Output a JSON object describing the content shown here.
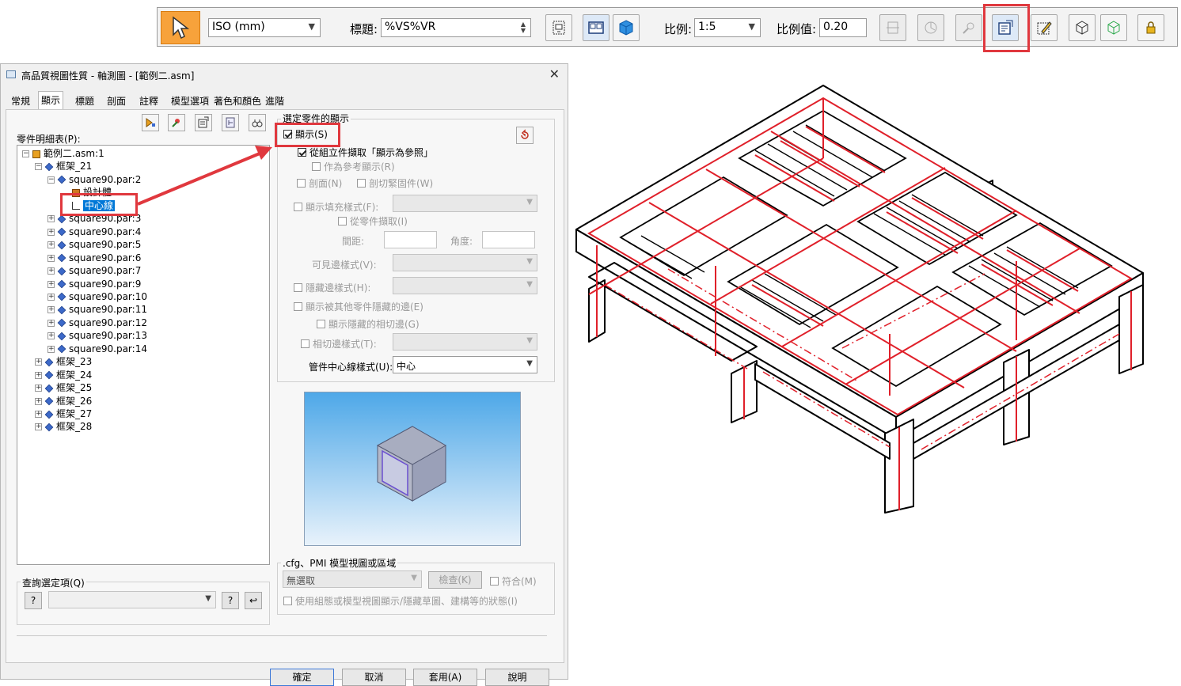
{
  "ribbon": {
    "view_type": "ISO (mm)",
    "title_label": "標題:",
    "title_value": "%VS%VR",
    "scale_label": "比例:",
    "scale_value": "1:5",
    "scale_factor_label": "比例值:",
    "scale_factor_value": "0.20"
  },
  "dialog": {
    "title": "高品質視圖性質 - 軸測圖 - [範例二.asm]",
    "close": "✕",
    "tabs": [
      "常規",
      "顯示",
      "標題",
      "剖面",
      "註釋",
      "模型選項",
      "著色和顏色",
      "進階"
    ],
    "active_tab": "顯示",
    "tree_label": "零件明細表(P):",
    "tree": [
      {
        "label": "範例二.asm:1",
        "level": 0,
        "exp": "−",
        "icon": "asm"
      },
      {
        "label": "框架_21",
        "level": 1,
        "exp": "−",
        "icon": "part"
      },
      {
        "label": "square90.par:2",
        "level": 2,
        "exp": "−",
        "icon": "part"
      },
      {
        "label": "設計體",
        "level": 3,
        "exp": "",
        "icon": "body"
      },
      {
        "label": "中心線",
        "level": 3,
        "exp": "",
        "icon": "line",
        "selected": true
      },
      {
        "label": "square90.par:3",
        "level": 2,
        "exp": "+",
        "icon": "part"
      },
      {
        "label": "square90.par:4",
        "level": 2,
        "exp": "+",
        "icon": "part"
      },
      {
        "label": "square90.par:5",
        "level": 2,
        "exp": "+",
        "icon": "part"
      },
      {
        "label": "square90.par:6",
        "level": 2,
        "exp": "+",
        "icon": "part"
      },
      {
        "label": "square90.par:7",
        "level": 2,
        "exp": "+",
        "icon": "part"
      },
      {
        "label": "square90.par:9",
        "level": 2,
        "exp": "+",
        "icon": "part"
      },
      {
        "label": "square90.par:10",
        "level": 2,
        "exp": "+",
        "icon": "part"
      },
      {
        "label": "square90.par:11",
        "level": 2,
        "exp": "+",
        "icon": "part"
      },
      {
        "label": "square90.par:12",
        "level": 2,
        "exp": "+",
        "icon": "part"
      },
      {
        "label": "square90.par:13",
        "level": 2,
        "exp": "+",
        "icon": "part"
      },
      {
        "label": "square90.par:14",
        "level": 2,
        "exp": "+",
        "icon": "part"
      },
      {
        "label": "框架_23",
        "level": 1,
        "exp": "+",
        "icon": "part"
      },
      {
        "label": "框架_24",
        "level": 1,
        "exp": "+",
        "icon": "part"
      },
      {
        "label": "框架_25",
        "level": 1,
        "exp": "+",
        "icon": "part"
      },
      {
        "label": "框架_26",
        "level": 1,
        "exp": "+",
        "icon": "part"
      },
      {
        "label": "框架_27",
        "level": 1,
        "exp": "+",
        "icon": "part"
      },
      {
        "label": "框架_28",
        "level": 1,
        "exp": "+",
        "icon": "part"
      }
    ],
    "query_label": "查詢選定項(Q)",
    "query_help": "?",
    "display_group_title": "選定零件的顯示",
    "show_checkbox": "顯示(S)",
    "from_assembly": "從組立件擷取「顯示為參照」",
    "as_reference": "作為參考顯示(R)",
    "section": "剖面(N)",
    "cut_fastener": "剖切緊固件(W)",
    "show_fill_style": "顯示填充樣式(F):",
    "from_part": "從零件擷取(I)",
    "spacing_label": "間距:",
    "angle_label": "角度:",
    "visible_edge_style": "可見邊樣式(V):",
    "hidden_edge_style": "隱藏邊樣式(H):",
    "show_hidden_by_other": "顯示被其他零件隱藏的邊(E)",
    "show_hidden_tangent": "顯示隱藏的相切邊(G)",
    "tangent_edge_style": "相切邊樣式(T):",
    "tube_centerline_style": "管件中心線樣式(U):",
    "tube_centerline_value": "中心",
    "cfg_group_title": ".cfg、PMI 模型視圖或區域",
    "cfg_value": "無選取",
    "check_button": "檢查(K)",
    "match_checkbox": "符合(M)",
    "use_config": "使用組態或模型視圖顯示/隱藏草圖、建構等的狀態(I)",
    "ok": "確定",
    "cancel": "取消",
    "apply": "套用(A)",
    "help": "說明"
  }
}
